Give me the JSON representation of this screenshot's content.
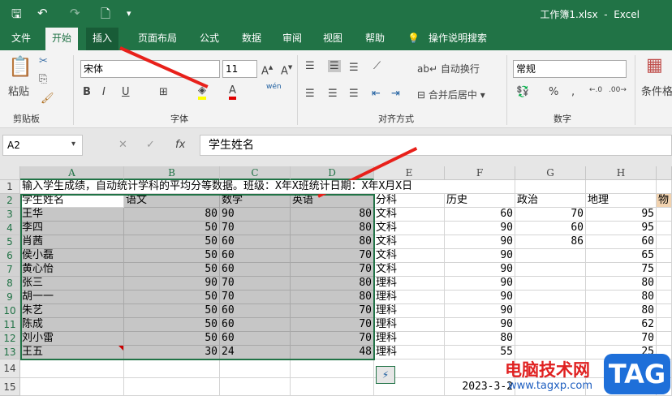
{
  "window": {
    "title": "工作簿1.xlsx  -  Excel"
  },
  "qat": {
    "icons": [
      "save-icon",
      "undo-icon",
      "redo-icon",
      "print-preview-icon",
      "customize-icon"
    ]
  },
  "tabs": [
    {
      "label": "文件"
    },
    {
      "label": "开始"
    },
    {
      "label": "插入"
    },
    {
      "label": "页面布局"
    },
    {
      "label": "公式"
    },
    {
      "label": "数据"
    },
    {
      "label": "审阅"
    },
    {
      "label": "视图"
    },
    {
      "label": "帮助"
    },
    {
      "label": "操作说明搜索"
    }
  ],
  "ribbon": {
    "clipboard": {
      "paste": "粘贴",
      "group": "剪贴板"
    },
    "font": {
      "name": "宋体",
      "size": "11",
      "group": "字体",
      "bold": "B",
      "italic": "I",
      "underline": "U",
      "fill_color": "#ffff00",
      "font_color": "#e00000",
      "phonetic": "wén"
    },
    "alignment": {
      "wrap": "自动换行",
      "merge": "合并后居中",
      "group": "对齐方式"
    },
    "number": {
      "format": "常规",
      "percent": "%",
      "comma": ",",
      "group": "数字"
    },
    "styles": {
      "conditional": "条件格"
    }
  },
  "formula_bar": {
    "name_box": "A2",
    "fx": "fx",
    "value": "学生姓名"
  },
  "sheet": {
    "columns": [
      "A",
      "B",
      "C",
      "D",
      "E",
      "F",
      "G",
      "H"
    ],
    "rows": [
      "1",
      "2",
      "3",
      "4",
      "5",
      "6",
      "7",
      "8",
      "9",
      "10",
      "11",
      "12",
      "13",
      "14",
      "15"
    ],
    "row1": "输入学生成绩，自动统计学科的平均分等数据。班级：X年X班统计日期：X年X月X日",
    "headers": [
      "学生姓名",
      "语文",
      "数学",
      "英语",
      "分科",
      "历史",
      "政治",
      "地理",
      "物"
    ],
    "data": [
      [
        "王华",
        "80",
        "90",
        "80",
        "文科",
        "60",
        "70",
        "95"
      ],
      [
        "李四",
        "50",
        "70",
        "80",
        "文科",
        "90",
        "60",
        "95"
      ],
      [
        "肖茜",
        "50",
        "60",
        "80",
        "文科",
        "90",
        "86",
        "60"
      ],
      [
        "侯小磊",
        "50",
        "60",
        "70",
        "文科",
        "90",
        "",
        "65"
      ],
      [
        "黄心怡",
        "50",
        "60",
        "70",
        "文科",
        "90",
        "",
        "75"
      ],
      [
        "张三",
        "90",
        "70",
        "80",
        "理科",
        "90",
        "",
        "80"
      ],
      [
        "胡一一",
        "50",
        "70",
        "80",
        "理科",
        "90",
        "",
        "80"
      ],
      [
        "朱艺",
        "50",
        "60",
        "70",
        "理科",
        "90",
        "",
        "80"
      ],
      [
        "陈成",
        "50",
        "60",
        "70",
        "理科",
        "90",
        "",
        "62"
      ],
      [
        "刘小雷",
        "50",
        "60",
        "70",
        "理科",
        "80",
        "",
        "70"
      ],
      [
        "王五",
        "30",
        "24",
        "48",
        "理科",
        "55",
        "",
        "25"
      ]
    ],
    "row15_f": "2023-3-2"
  },
  "watermark": {
    "cn": "电脑技术网",
    "url": "www.tagxp.com",
    "badge": "TAG"
  }
}
